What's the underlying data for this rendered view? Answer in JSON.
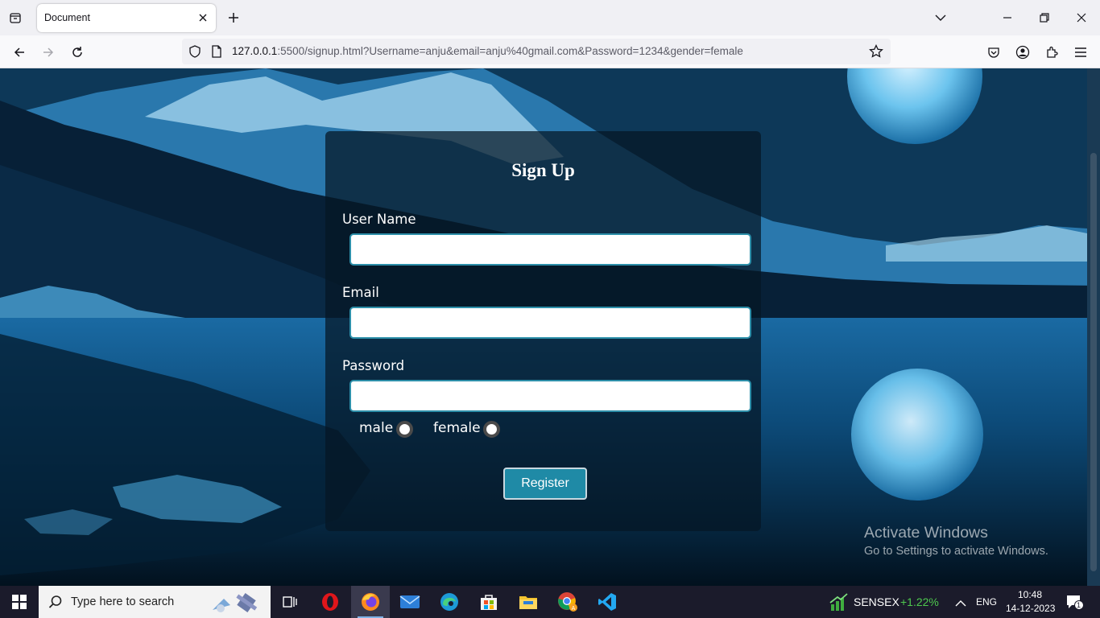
{
  "browser": {
    "tab_title": "Document",
    "url_host": "127.0.0.1",
    "url_rest": ":5500/signup.html?Username=anju&email=anju%40gmail.com&Password=1234&gender=female"
  },
  "form": {
    "title": "Sign Up",
    "username_label": "User Name",
    "username_value": "",
    "email_label": "Email",
    "email_value": "",
    "password_label": "Password",
    "password_value": "",
    "gender_options": [
      "male",
      "female"
    ],
    "register_label": "Register"
  },
  "watermark": {
    "title": "Activate Windows",
    "subtitle": "Go to Settings to activate Windows."
  },
  "taskbar": {
    "search_placeholder": "Type here to search",
    "stock_name": "SENSEX",
    "stock_change": "+1.22%",
    "language": "ENG",
    "time": "10:48",
    "date": "14-12-2023",
    "notification_count": "1"
  },
  "colors": {
    "accent": "#1f8aa6",
    "stock_up": "#4ec94e"
  }
}
